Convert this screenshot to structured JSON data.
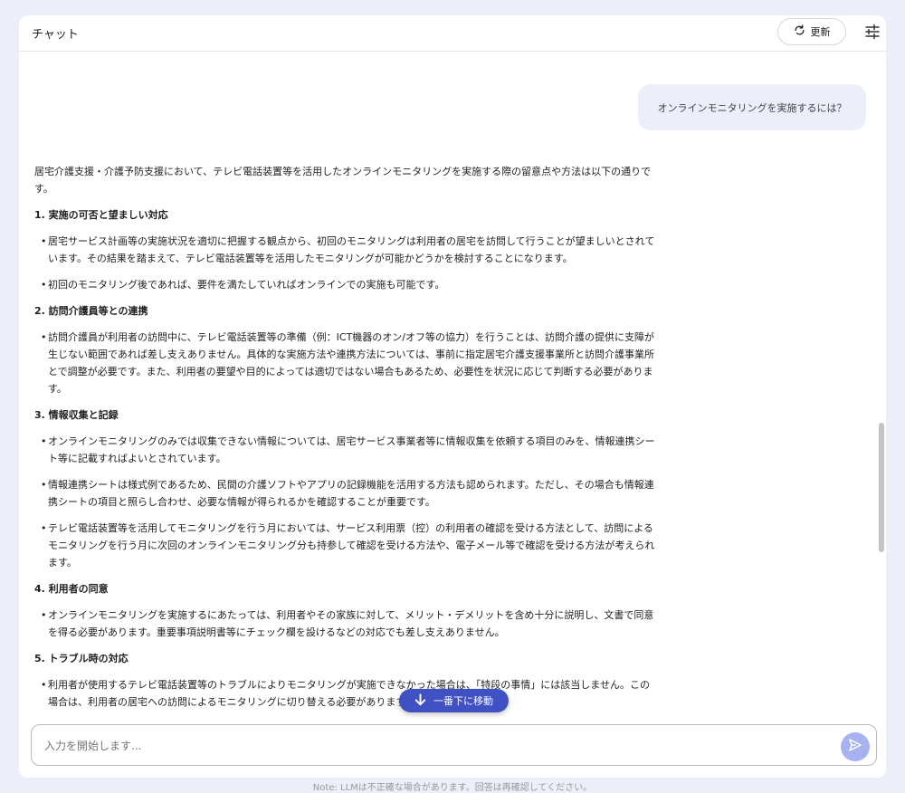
{
  "header": {
    "title": "チャット",
    "refresh_label": "更新"
  },
  "user_message": "オンラインモニタリングを実施するには？",
  "answer": {
    "intro": "居宅介護支援・介護予防支援において、テレビ電話装置等を活用したオンラインモニタリングを実施する際の留意点や方法は以下の通りです。",
    "sections": [
      {
        "heading": "1. 実施の可否と望ましい対応",
        "items": [
          "居宅サービス計画等の実施状況を適切に把握する観点から、初回のモニタリングは利用者の居宅を訪問して行うことが望ましいとされています。その結果を踏まえて、テレビ電話装置等を活用したモニタリングが可能かどうかを検討することになります。",
          "初回のモニタリング後であれば、要件を満たしていればオンラインでの実施も可能です。"
        ]
      },
      {
        "heading": "2. 訪問介護員等との連携",
        "items": [
          "訪問介護員が利用者の訪問中に、テレビ電話装置等の準備（例：ICT機器のオン/オフ等の協力）を行うことは、訪問介護の提供に支障が生じない範囲であれば差し支えありません。具体的な実施方法や連携方法については、事前に指定居宅介護支援事業所と訪問介護事業所とで調整が必要です。また、利用者の要望や目的によっては適切ではない場合もあるため、必要性を状況に応じて判断する必要があります。"
        ]
      },
      {
        "heading": "3. 情報収集と記録",
        "items": [
          "オンラインモニタリングのみでは収集できない情報については、居宅サービス事業者等に情報収集を依頼する項目のみを、情報連携シート等に記載すればよいとされています。",
          "情報連携シートは様式例であるため、民間の介護ソフトやアプリの記録機能を活用する方法も認められます。ただし、その場合も情報連携シートの項目と照らし合わせ、必要な情報が得られるかを確認することが重要です。",
          "テレビ電話装置等を活用してモニタリングを行う月においては、サービス利用票（控）の利用者の確認を受ける方法として、訪問によるモニタリングを行う月に次回のオンラインモニタリング分も持参して確認を受ける方法や、電子メール等で確認を受ける方法が考えられます。"
        ]
      },
      {
        "heading": "4. 利用者の同意",
        "items": [
          "オンラインモニタリングを実施するにあたっては、利用者やその家族に対して、メリット・デメリットを含め十分に説明し、文書で同意を得る必要があります。重要事項説明書等にチェック欄を設けるなどの対応でも差し支えありません。"
        ]
      },
      {
        "heading": "5. トラブル時の対応",
        "items": [
          "利用者が使用するテレビ電話装置等のトラブルによりモニタリングが実施できなかった場合は、「特段の事情」には該当しません。この場合は、利用者の居宅への訪問によるモニタリングに切り替える必要があります。"
        ]
      }
    ]
  },
  "jump_button": "一番下に移動",
  "input": {
    "placeholder": "入力を開始します..."
  },
  "footer_note": "Note: LLMは不正確な場合があります。回答は再確認してください。",
  "icons": {
    "refresh": "refresh-icon",
    "settings": "sliders-icon",
    "jump": "arrow-down-icon",
    "send": "send-icon"
  },
  "colors": {
    "background": "#eceef9",
    "accent": "#4051c4",
    "send_button": "#a7b2f0",
    "user_bubble": "#eceef9"
  }
}
